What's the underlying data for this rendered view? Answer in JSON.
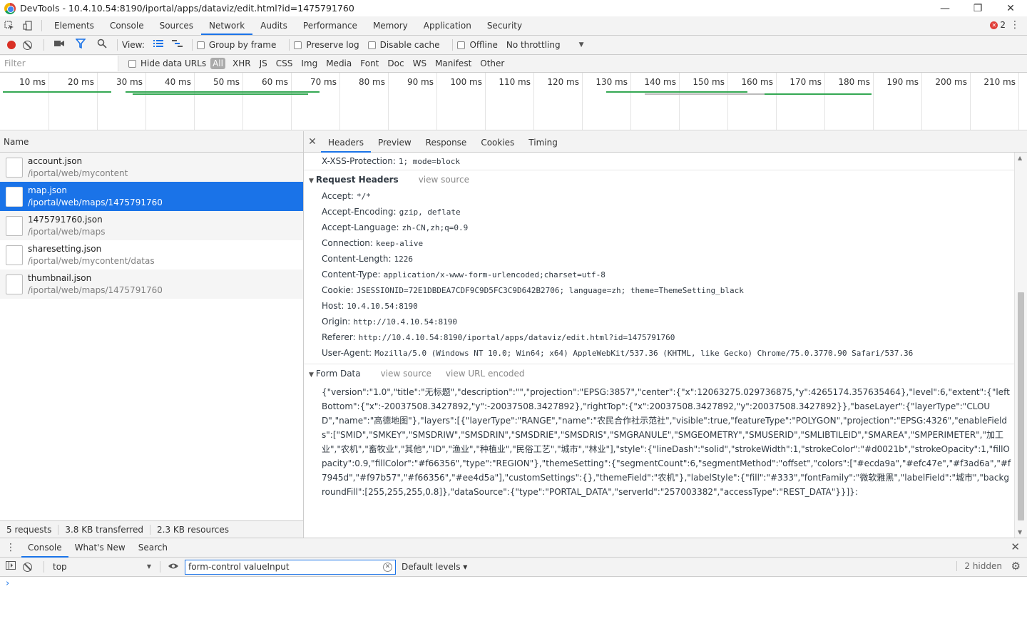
{
  "window": {
    "title": "DevTools - 10.4.10.54:8190/iportal/apps/dataviz/edit.html?id=1475791760",
    "minimize": "—",
    "restore": "❐",
    "close": "✕"
  },
  "tabs": [
    "Elements",
    "Console",
    "Sources",
    "Network",
    "Audits",
    "Performance",
    "Memory",
    "Application",
    "Security"
  ],
  "active_tab": "Network",
  "error_count": "2",
  "toolbar": {
    "view_label": "View:",
    "group_by_frame": "Group by frame",
    "preserve_log": "Preserve log",
    "disable_cache": "Disable cache",
    "offline": "Offline",
    "throttling": "No throttling"
  },
  "filter": {
    "placeholder": "Filter",
    "hide_data_urls": "Hide data URLs",
    "types": [
      "All",
      "XHR",
      "JS",
      "CSS",
      "Img",
      "Media",
      "Font",
      "Doc",
      "WS",
      "Manifest",
      "Other"
    ],
    "active_type": "All"
  },
  "timeline": {
    "ticks": [
      "10 ms",
      "20 ms",
      "30 ms",
      "40 ms",
      "50 ms",
      "60 ms",
      "70 ms",
      "80 ms",
      "90 ms",
      "100 ms",
      "110 ms",
      "120 ms",
      "130 ms",
      "140 ms",
      "150 ms",
      "160 ms",
      "170 ms",
      "180 ms",
      "190 ms",
      "200 ms",
      "210 ms"
    ]
  },
  "request_list": {
    "header": "Name",
    "requests": [
      {
        "name": "account.json",
        "path": "/iportal/web/mycontent"
      },
      {
        "name": "map.json",
        "path": "/iportal/web/maps/1475791760"
      },
      {
        "name": "1475791760.json",
        "path": "/iportal/web/maps"
      },
      {
        "name": "sharesetting.json",
        "path": "/iportal/web/mycontent/datas"
      },
      {
        "name": "thumbnail.json",
        "path": "/iportal/web/maps/1475791760"
      }
    ],
    "selected_index": 1
  },
  "status": {
    "requests": "5 requests",
    "transferred": "3.8 KB transferred",
    "resources": "2.3 KB resources"
  },
  "details": {
    "tabs": [
      "Headers",
      "Preview",
      "Response",
      "Cookies",
      "Timing"
    ],
    "active_tab": "Headers",
    "top_header": {
      "key": "X-XSS-Protection:",
      "value": "1; mode=block"
    },
    "request_headers_title": "Request Headers",
    "view_source": "view source",
    "request_headers": [
      {
        "key": "Accept:",
        "value": "*/*"
      },
      {
        "key": "Accept-Encoding:",
        "value": "gzip, deflate"
      },
      {
        "key": "Accept-Language:",
        "value": "zh-CN,zh;q=0.9"
      },
      {
        "key": "Connection:",
        "value": "keep-alive"
      },
      {
        "key": "Content-Length:",
        "value": "1226"
      },
      {
        "key": "Content-Type:",
        "value": "application/x-www-form-urlencoded;charset=utf-8"
      },
      {
        "key": "Cookie:",
        "value": "JSESSIONID=72E1DBDEA7CDF9C9D5FC3C9D642B2706; language=zh; theme=ThemeSetting_black"
      },
      {
        "key": "Host:",
        "value": "10.4.10.54:8190"
      },
      {
        "key": "Origin:",
        "value": "http://10.4.10.54:8190"
      },
      {
        "key": "Referer:",
        "value": "http://10.4.10.54:8190/iportal/apps/dataviz/edit.html?id=1475791760"
      },
      {
        "key": "User-Agent:",
        "value": "Mozilla/5.0 (Windows NT 10.0; Win64; x64) AppleWebKit/537.36 (KHTML, like Gecko) Chrome/75.0.3770.90 Safari/537.36"
      }
    ],
    "form_data_title": "Form Data",
    "view_url_encoded": "view URL encoded",
    "form_data": "{\"version\":\"1.0\",\"title\":\"无标题\",\"description\":\"\",\"projection\":\"EPSG:3857\",\"center\":{\"x\":12063275.029736875,\"y\":4265174.357635464},\"level\":6,\"extent\":{\"leftBottom\":{\"x\":-20037508.3427892,\"y\":-20037508.3427892},\"rightTop\":{\"x\":20037508.3427892,\"y\":20037508.3427892}},\"baseLayer\":{\"layerType\":\"CLOUD\",\"name\":\"高德地图\"},\"layers\":[{\"layerType\":\"RANGE\",\"name\":\"农民合作社示范社\",\"visible\":true,\"featureType\":\"POLYGON\",\"projection\":\"EPSG:4326\",\"enableFields\":[\"SMID\",\"SMKEY\",\"SMSDRIW\",\"SMSDRIN\",\"SMSDRIE\",\"SMSDRIS\",\"SMGRANULE\",\"SMGEOMETRY\",\"SMUSERID\",\"SMLIBTILEID\",\"SMAREA\",\"SMPERIMETER\",\"加工业\",\"农机\",\"畜牧业\",\"其他\",\"ID\",\"渔业\",\"种植业\",\"民俗工艺\",\"城市\",\"林业\"],\"style\":{\"lineDash\":\"solid\",\"strokeWidth\":1,\"strokeColor\":\"#d0021b\",\"strokeOpacity\":1,\"fillOpacity\":0.9,\"fillColor\":\"#f66356\",\"type\":\"REGION\"},\"themeSetting\":{\"segmentCount\":6,\"segmentMethod\":\"offset\",\"colors\":[\"#ecda9a\",\"#efc47e\",\"#f3ad6a\",\"#f7945d\",\"#f97b57\",\"#f66356\",\"#ee4d5a\"],\"customSettings\":{},\"themeField\":\"农机\"},\"labelStyle\":{\"fill\":\"#333\",\"fontFamily\":\"微软雅黑\",\"labelField\":\"城市\",\"backgroundFill\":[255,255,255,0.8]},\"dataSource\":{\"type\":\"PORTAL_DATA\",\"serverId\":\"257003382\",\"accessType\":\"REST_DATA\"}}]}:"
  },
  "drawer": {
    "tabs": [
      "Console",
      "What's New",
      "Search"
    ],
    "active_tab": "Console",
    "context": "top",
    "filter_value": "form-control valueInput",
    "levels": "Default levels ▾",
    "hidden": "2 hidden"
  }
}
